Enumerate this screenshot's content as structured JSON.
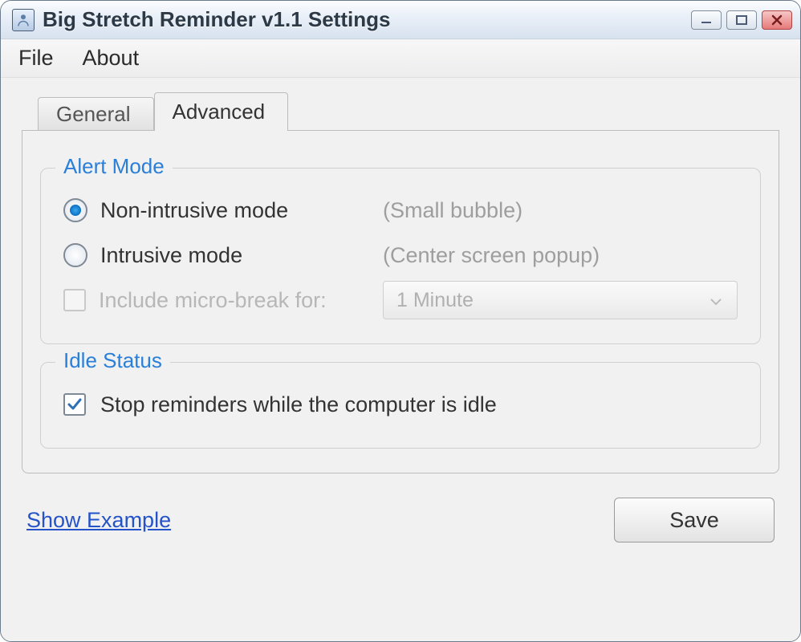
{
  "window": {
    "title": "Big Stretch Reminder v1.1 Settings"
  },
  "menubar": {
    "items": [
      "File",
      "About"
    ]
  },
  "tabs": {
    "items": [
      {
        "label": "General",
        "active": false
      },
      {
        "label": "Advanced",
        "active": true
      }
    ]
  },
  "groups": {
    "alert_mode": {
      "legend": "Alert Mode",
      "options": [
        {
          "label": "Non-intrusive mode",
          "hint": "(Small bubble)",
          "selected": true
        },
        {
          "label": "Intrusive mode",
          "hint": "(Center screen popup)",
          "selected": false
        }
      ],
      "microbreak": {
        "label": "Include micro-break for:",
        "checked": false,
        "value": "1 Minute"
      }
    },
    "idle_status": {
      "legend": "Idle Status",
      "stop_idle": {
        "label": "Stop reminders while the computer is idle",
        "checked": true
      }
    }
  },
  "footer": {
    "link": "Show Example",
    "save": "Save"
  }
}
